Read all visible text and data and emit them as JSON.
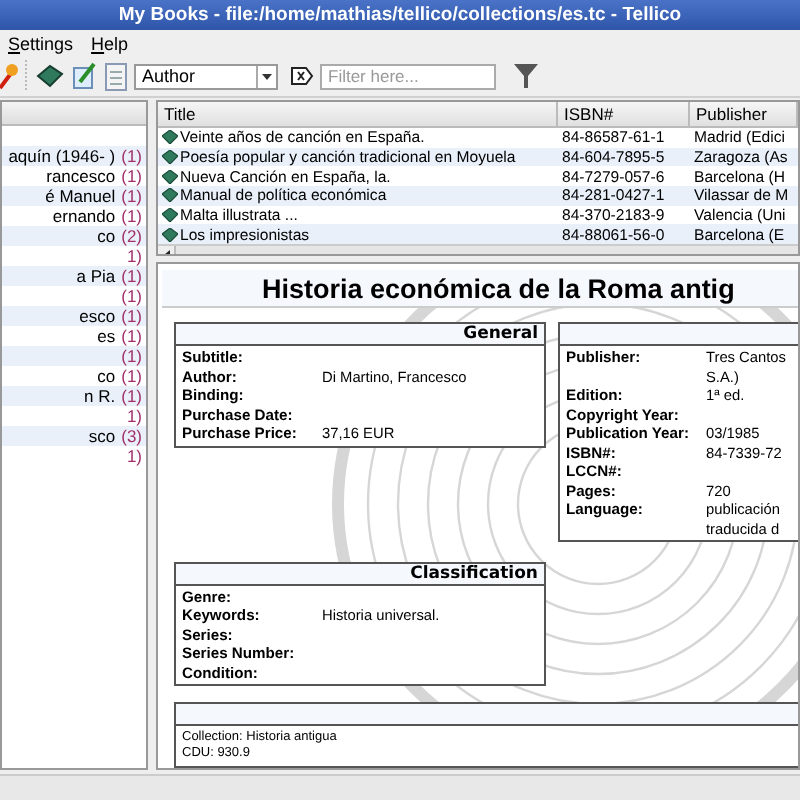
{
  "window": {
    "title": "My Books - file:/home/mathias/tellico/collections/es.tc - Tellico"
  },
  "menu": [
    "Settings",
    "Help"
  ],
  "toolbar": {
    "group_by": "Author",
    "filter": {
      "placeholder": "Filter here..."
    }
  },
  "groups": [
    {
      "label": "aquín (1946- )",
      "count": "(1)"
    },
    {
      "label": "rancesco",
      "count": "(1)"
    },
    {
      "label": "é Manuel",
      "count": "(1)"
    },
    {
      "label": "ernando",
      "count": "(1)"
    },
    {
      "label": "co",
      "count": "(2)"
    },
    {
      "count": "1)"
    },
    {
      "label": "a Pia",
      "count": "(1)"
    },
    {
      "count": "(1)"
    },
    {
      "label": "esco",
      "count": "(1)"
    },
    {
      "label": "es",
      "count": "(1)"
    },
    {
      "count": "(1)"
    },
    {
      "label": "co",
      "count": "(1)"
    },
    {
      "label": "n R.",
      "count": "(1)"
    },
    {
      "count": "1)"
    },
    {
      "label": "sco",
      "count": "(3)"
    },
    {
      "count": "1)"
    }
  ],
  "table": {
    "columns": [
      "Title",
      "ISBN#",
      "Publisher"
    ],
    "rows": [
      [
        "Veinte años de canción en España.",
        "84-86587-61-1",
        "Madrid (Edici"
      ],
      [
        "Poesía popular y canción tradicional en Moyuela",
        "84-604-7895-5",
        "Zaragoza (As"
      ],
      [
        "Nueva Canción en España, la.",
        "84-7279-057-6",
        "Barcelona (H"
      ],
      [
        "Manual de política económica",
        "84-281-0427-1",
        "Vilassar de M"
      ],
      [
        "Malta illustrata ...",
        "84-370-2183-9",
        "Valencia (Uni"
      ],
      [
        "Los impresionistas",
        "84-88061-56-0",
        "Barcelona (E"
      ]
    ]
  },
  "entry": {
    "title": "Historia económica de la Roma antig",
    "general": {
      "heading": "General",
      "fields": [
        {
          "label": "Subtitle:"
        },
        {
          "label": "Author:",
          "lines": [
            "Di Martino, Francesco"
          ]
        },
        {
          "label": "Binding:"
        },
        {
          "label": "Purchase Date:"
        },
        {
          "label": "Purchase Price:",
          "lines": [
            "37,16 EUR"
          ]
        }
      ]
    },
    "publishing": {
      "fields": [
        {
          "label": "Publisher:",
          "lines": [
            "Tres Cantos",
            "S.A.)"
          ]
        },
        {
          "label": "Edition:",
          "lines": [
            "1ª ed."
          ]
        },
        {
          "label": "Copyright Year:"
        },
        {
          "label": "Publication Year:",
          "lines": [
            "03/1985"
          ]
        },
        {
          "label": "ISBN#:",
          "lines": [
            "84-7339-72"
          ]
        },
        {
          "label": "LCCN#:"
        },
        {
          "label": "Pages:",
          "lines": [
            "720"
          ]
        },
        {
          "label": "Language:",
          "lines": [
            "publicación",
            "traducida d"
          ]
        }
      ]
    },
    "classification": {
      "heading": "Classification",
      "fields": [
        {
          "label": "Genre:"
        },
        {
          "label": "Keywords:",
          "lines": [
            "Historia universal."
          ]
        },
        {
          "label": "Series:"
        },
        {
          "label": "Series Number:"
        },
        {
          "label": "Condition:"
        }
      ]
    },
    "notes": [
      "Collection: Historia antigua",
      "CDU: 930.9"
    ]
  }
}
